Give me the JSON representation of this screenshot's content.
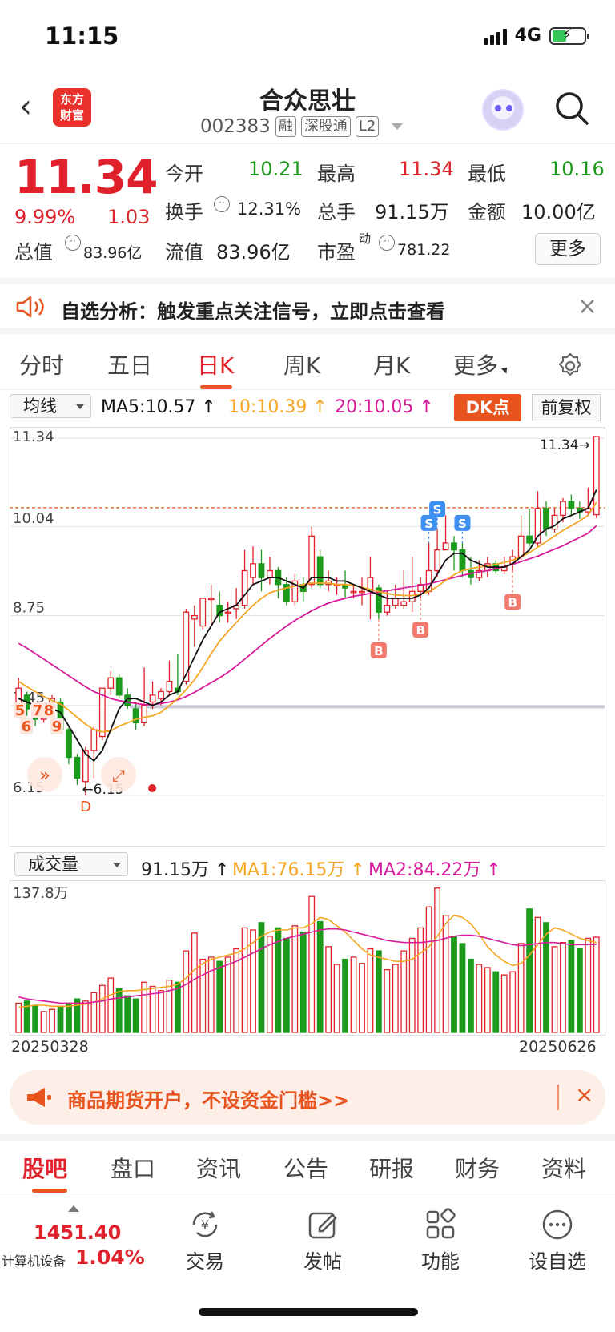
{
  "status": {
    "time": "11:15",
    "network": "4G"
  },
  "header": {
    "title": "合众思壮",
    "code": "002383",
    "tags": [
      "融",
      "深股通",
      "L2"
    ],
    "logo_line1": "东方",
    "logo_line2": "财富"
  },
  "quote": {
    "price": "11.34",
    "change_pct": "9.99%",
    "change": "1.03",
    "open_label": "今开",
    "open": "10.21",
    "high_label": "最高",
    "high": "11.34",
    "low_label": "最低",
    "low": "10.16",
    "turnover_label": "换手",
    "turnover": "12.31%",
    "volume_label": "总手",
    "volume": "91.15万",
    "amount_label": "金额",
    "amount": "10.00亿",
    "mcap_label": "总值",
    "mcap": "83.96亿",
    "float_label": "流值",
    "float": "83.96亿",
    "pe_label": "市盈",
    "pe_sup": "动",
    "pe": "781.22",
    "more": "更多"
  },
  "banner": {
    "text": "自选分析：触发重点关注信号，立即点击查看"
  },
  "ktabs": [
    "分时",
    "五日",
    "日K",
    "周K",
    "月K",
    "更多"
  ],
  "ma_bar": {
    "select": "均线",
    "ma5": "MA5:10.57",
    "ma10": "10:10.39",
    "ma20": "20:10.05",
    "dk": "DK点",
    "fq": "前复权"
  },
  "colors": {
    "up": "#e0202a",
    "down": "#1b9a1b",
    "ma5": "#111111",
    "ma10": "#f5a623",
    "ma20": "#d81b9c",
    "accent": "#e8541e"
  },
  "chart_data": [
    {
      "type": "candlestick",
      "ylim": [
        6.15,
        11.34
      ],
      "y_ticks": [
        "11.34",
        "10.04",
        "8.75",
        "7.45",
        "6.15"
      ],
      "max_label": "11.34→",
      "min_label": "←6.15",
      "reference_line": 10.31,
      "signals": [
        {
          "text": "S",
          "kind": "sell",
          "index": 53
        },
        {
          "text": "S",
          "kind": "sell",
          "index": 50
        },
        {
          "text": "S",
          "kind": "sell",
          "index": 49
        },
        {
          "text": "B",
          "kind": "buy",
          "index": 43
        },
        {
          "text": "B",
          "kind": "buy",
          "index": 48
        },
        {
          "text": "B",
          "kind": "buy",
          "index": 59
        },
        {
          "text": "D",
          "kind": "buy",
          "index": 8
        }
      ],
      "count_labels": [
        "5",
        "6",
        "7",
        "8",
        "9"
      ],
      "candles": [
        [
          7.45,
          7.7,
          7.85,
          7.4
        ],
        [
          7.6,
          7.4,
          7.65,
          7.3
        ],
        [
          7.4,
          7.25,
          7.45,
          7.15
        ],
        [
          7.25,
          7.45,
          7.5,
          7.2
        ],
        [
          7.45,
          7.55,
          7.6,
          7.35
        ],
        [
          7.5,
          7.1,
          7.55,
          7.05
        ],
        [
          7.1,
          6.7,
          7.15,
          6.6
        ],
        [
          6.7,
          6.4,
          6.75,
          6.3
        ],
        [
          6.35,
          6.8,
          6.85,
          6.15
        ],
        [
          6.8,
          7.1,
          7.15,
          6.4
        ],
        [
          7.0,
          7.7,
          7.7,
          6.95
        ],
        [
          7.7,
          7.85,
          7.95,
          7.6
        ],
        [
          7.85,
          7.6,
          7.9,
          7.55
        ],
        [
          7.6,
          7.45,
          7.7,
          7.4
        ],
        [
          7.4,
          7.2,
          7.5,
          7.1
        ],
        [
          7.2,
          7.45,
          8.0,
          7.15
        ],
        [
          7.5,
          7.6,
          7.8,
          7.4
        ],
        [
          7.55,
          7.65,
          7.7,
          7.45
        ],
        [
          7.65,
          7.8,
          8.1,
          7.6
        ],
        [
          7.7,
          7.65,
          8.2,
          7.6
        ],
        [
          7.8,
          8.8,
          8.85,
          7.75
        ],
        [
          8.7,
          8.75,
          8.9,
          8.3
        ],
        [
          8.6,
          9.0,
          9.0,
          8.55
        ],
        [
          9.0,
          9.0,
          9.2,
          8.6
        ],
        [
          8.9,
          8.75,
          9.1,
          8.65
        ],
        [
          8.8,
          8.8,
          8.95,
          8.65
        ],
        [
          8.85,
          8.9,
          9.15,
          8.7
        ],
        [
          8.9,
          9.4,
          9.7,
          8.85
        ],
        [
          9.3,
          9.5,
          9.75,
          9.2
        ],
        [
          9.5,
          9.3,
          9.7,
          9.1
        ],
        [
          9.3,
          9.4,
          9.6,
          9.2
        ],
        [
          9.4,
          9.2,
          9.45,
          9.0
        ],
        [
          9.2,
          8.95,
          9.3,
          8.9
        ],
        [
          8.95,
          9.25,
          9.35,
          8.9
        ],
        [
          9.2,
          9.1,
          9.3,
          8.95
        ],
        [
          9.2,
          9.9,
          10.04,
          9.15
        ],
        [
          9.6,
          9.2,
          9.7,
          9.15
        ],
        [
          9.2,
          9.25,
          9.4,
          9.1
        ],
        [
          9.2,
          9.2,
          9.3,
          9.05
        ],
        [
          9.2,
          9.15,
          9.4,
          9.0
        ],
        [
          9.1,
          9.1,
          9.2,
          9.0
        ],
        [
          9.1,
          9.1,
          9.3,
          8.9
        ],
        [
          9.1,
          9.3,
          9.6,
          8.7
        ],
        [
          9.15,
          8.8,
          9.2,
          8.7
        ],
        [
          8.8,
          8.9,
          9.1,
          8.75
        ],
        [
          8.9,
          9.0,
          9.2,
          8.85
        ],
        [
          8.9,
          8.95,
          9.4,
          8.85
        ],
        [
          8.95,
          9.1,
          9.6,
          8.8
        ],
        [
          9.1,
          9.2,
          9.3,
          9.0
        ],
        [
          9.1,
          9.4,
          9.8,
          9.05
        ],
        [
          9.4,
          9.7,
          10.0,
          9.3
        ],
        [
          9.7,
          9.8,
          10.2,
          9.7
        ],
        [
          9.8,
          9.7,
          9.9,
          9.4
        ],
        [
          9.7,
          9.4,
          9.8,
          9.3
        ],
        [
          9.4,
          9.3,
          9.6,
          9.2
        ],
        [
          9.3,
          9.4,
          9.55,
          9.25
        ],
        [
          9.4,
          9.5,
          9.6,
          9.3
        ],
        [
          9.5,
          9.4,
          9.55,
          9.35
        ],
        [
          9.4,
          9.45,
          9.6,
          9.35
        ],
        [
          9.5,
          9.6,
          9.7,
          9.4
        ],
        [
          9.6,
          9.9,
          10.2,
          9.55
        ],
        [
          9.9,
          9.8,
          10.3,
          9.75
        ],
        [
          9.8,
          10.3,
          10.55,
          9.75
        ],
        [
          10.3,
          10.0,
          10.4,
          9.9
        ],
        [
          10.0,
          10.2,
          10.3,
          9.95
        ],
        [
          10.2,
          10.4,
          10.45,
          10.1
        ],
        [
          10.4,
          10.3,
          10.5,
          10.2
        ],
        [
          10.3,
          10.25,
          10.4,
          10.15
        ],
        [
          10.25,
          10.3,
          10.6,
          10.2
        ],
        [
          10.21,
          11.34,
          11.34,
          10.16
        ]
      ],
      "ma5": [
        7.55,
        7.5,
        7.45,
        7.4,
        7.4,
        7.35,
        7.15,
        6.95,
        6.75,
        6.65,
        6.8,
        7.1,
        7.4,
        7.55,
        7.55,
        7.5,
        7.45,
        7.5,
        7.6,
        7.65,
        7.9,
        8.15,
        8.4,
        8.6,
        8.8,
        8.85,
        8.9,
        9.05,
        9.2,
        9.25,
        9.3,
        9.3,
        9.25,
        9.2,
        9.15,
        9.3,
        9.3,
        9.3,
        9.25,
        9.25,
        9.2,
        9.15,
        9.1,
        9.05,
        9.0,
        9.0,
        9.0,
        9.0,
        9.05,
        9.15,
        9.35,
        9.55,
        9.65,
        9.65,
        9.55,
        9.5,
        9.45,
        9.45,
        9.45,
        9.5,
        9.6,
        9.7,
        9.9,
        10.0,
        10.05,
        10.15,
        10.2,
        10.25,
        10.3,
        10.57
      ],
      "ma10": [
        7.8,
        7.72,
        7.65,
        7.58,
        7.52,
        7.47,
        7.38,
        7.28,
        7.18,
        7.1,
        7.07,
        7.08,
        7.15,
        7.2,
        7.25,
        7.28,
        7.3,
        7.35,
        7.45,
        7.55,
        7.68,
        7.82,
        8.0,
        8.2,
        8.38,
        8.52,
        8.65,
        8.78,
        8.9,
        9.0,
        9.08,
        9.12,
        9.15,
        9.18,
        9.2,
        9.22,
        9.22,
        9.22,
        9.2,
        9.2,
        9.19,
        9.16,
        9.13,
        9.1,
        9.07,
        9.05,
        9.04,
        9.04,
        9.06,
        9.1,
        9.17,
        9.26,
        9.34,
        9.4,
        9.43,
        9.45,
        9.47,
        9.49,
        9.52,
        9.55,
        9.6,
        9.66,
        9.74,
        9.82,
        9.9,
        9.98,
        10.05,
        10.12,
        10.2,
        10.39
      ],
      "ma20": [
        8.35,
        8.28,
        8.2,
        8.12,
        8.04,
        7.96,
        7.88,
        7.8,
        7.72,
        7.65,
        7.6,
        7.55,
        7.52,
        7.5,
        7.48,
        7.46,
        7.46,
        7.48,
        7.5,
        7.53,
        7.58,
        7.64,
        7.71,
        7.78,
        7.85,
        7.93,
        8.02,
        8.12,
        8.22,
        8.32,
        8.42,
        8.51,
        8.6,
        8.68,
        8.75,
        8.82,
        8.88,
        8.93,
        8.97,
        9.0,
        9.03,
        9.05,
        9.07,
        9.09,
        9.11,
        9.13,
        9.15,
        9.17,
        9.19,
        9.21,
        9.24,
        9.27,
        9.3,
        9.33,
        9.36,
        9.38,
        9.4,
        9.43,
        9.46,
        9.49,
        9.53,
        9.57,
        9.61,
        9.66,
        9.71,
        9.76,
        9.82,
        9.88,
        9.94,
        10.05
      ]
    },
    {
      "type": "bar",
      "ylim": [
        0,
        137.8
      ],
      "y_ticks": [
        "137.8万"
      ],
      "x_start": "20250328",
      "x_end": "20250626",
      "volume": [
        28,
        30,
        26,
        20,
        22,
        25,
        28,
        32,
        30,
        38,
        45,
        52,
        42,
        35,
        32,
        48,
        44,
        40,
        50,
        48,
        78,
        95,
        70,
        72,
        68,
        72,
        80,
        100,
        98,
        105,
        92,
        100,
        90,
        102,
        96,
        130,
        106,
        82,
        65,
        70,
        72,
        66,
        80,
        78,
        60,
        65,
        78,
        90,
        100,
        120,
        138,
        112,
        92,
        85,
        70,
        65,
        62,
        58,
        55,
        58,
        85,
        118,
        110,
        105,
        82,
        86,
        88,
        80,
        90,
        91.15
      ],
      "vol_ma1": [
        24,
        25,
        26,
        26,
        25,
        25,
        25,
        26,
        27,
        29,
        32,
        36,
        39,
        40,
        40,
        41,
        42,
        43,
        44,
        46,
        52,
        60,
        66,
        70,
        72,
        74,
        76,
        80,
        86,
        92,
        96,
        98,
        98,
        100,
        100,
        104,
        110,
        108,
        102,
        96,
        88,
        80,
        74,
        72,
        70,
        68,
        68,
        70,
        76,
        82,
        92,
        104,
        112,
        110,
        104,
        94,
        82,
        74,
        68,
        64,
        66,
        74,
        84,
        94,
        100,
        98,
        94,
        90,
        88,
        86
      ],
      "vol_ma2": [
        34,
        32,
        31,
        30,
        29,
        28,
        28,
        28,
        28,
        29,
        30,
        32,
        33,
        34,
        35,
        36,
        37,
        38,
        40,
        42,
        46,
        51,
        55,
        59,
        62,
        65,
        68,
        72,
        76,
        80,
        84,
        87,
        90,
        92,
        94,
        96,
        98,
        99,
        99,
        98,
        96,
        94,
        92,
        90,
        88,
        87,
        86,
        86,
        86,
        87,
        88,
        90,
        92,
        93,
        93,
        92,
        90,
        88,
        86,
        84,
        83,
        84,
        85,
        86,
        86,
        85,
        84,
        84,
        84,
        84.22
      ]
    }
  ],
  "vol_bar": {
    "select": "成交量",
    "vol": "91.15万",
    "ma1": "MA1:76.15万",
    "ma2": "MA2:84.22万"
  },
  "ad": {
    "text": "商品期货开户，不设资金门槛>>"
  },
  "btabs": [
    "股吧",
    "盘口",
    "资讯",
    "公告",
    "研报",
    "财务",
    "资料"
  ],
  "footer": {
    "sector_value": "1451.40",
    "sector_name": "计算机设备",
    "sector_pct": "1.04%",
    "buttons": [
      "交易",
      "发帖",
      "功能",
      "设自选"
    ]
  }
}
